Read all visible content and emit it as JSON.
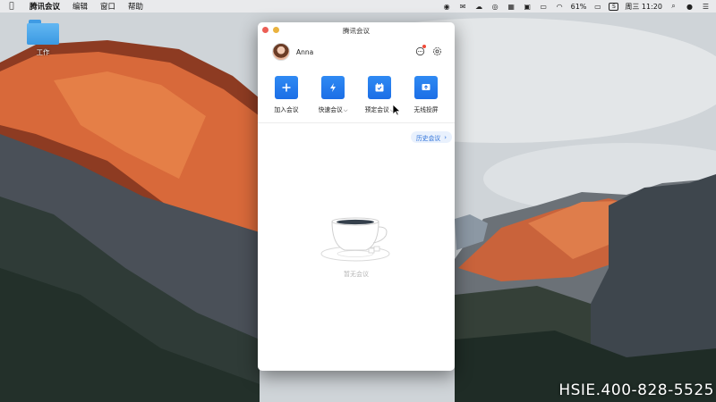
{
  "menubar": {
    "apple_icon": "apple-icon",
    "items": [
      "腾讯会议",
      "编辑",
      "窗口",
      "帮助"
    ],
    "status": {
      "battery_text": "61%",
      "clock": "周三 11:20",
      "input_method": "S"
    }
  },
  "desktop": {
    "folder_label": "工作"
  },
  "window": {
    "title": "腾讯会议",
    "user": {
      "name": "Anna"
    },
    "actions": [
      {
        "label": "加入会议",
        "icon": "plus-icon",
        "has_caret": false
      },
      {
        "label": "快速会议",
        "icon": "lightning-icon",
        "has_caret": true
      },
      {
        "label": "预定会议",
        "icon": "calendar-icon",
        "has_caret": true
      },
      {
        "label": "无线投屏",
        "icon": "screen-cast-icon",
        "has_caret": false
      }
    ],
    "history_button": "历史会议",
    "empty_state": "暂无会议"
  },
  "watermark": "HSIE.400-828-5525",
  "colors": {
    "accent": "#1c6ee6",
    "history_bg": "#e9f1fd",
    "close": "#ec5e55",
    "minimize": "#eab23e",
    "notification": "#f04a38"
  }
}
